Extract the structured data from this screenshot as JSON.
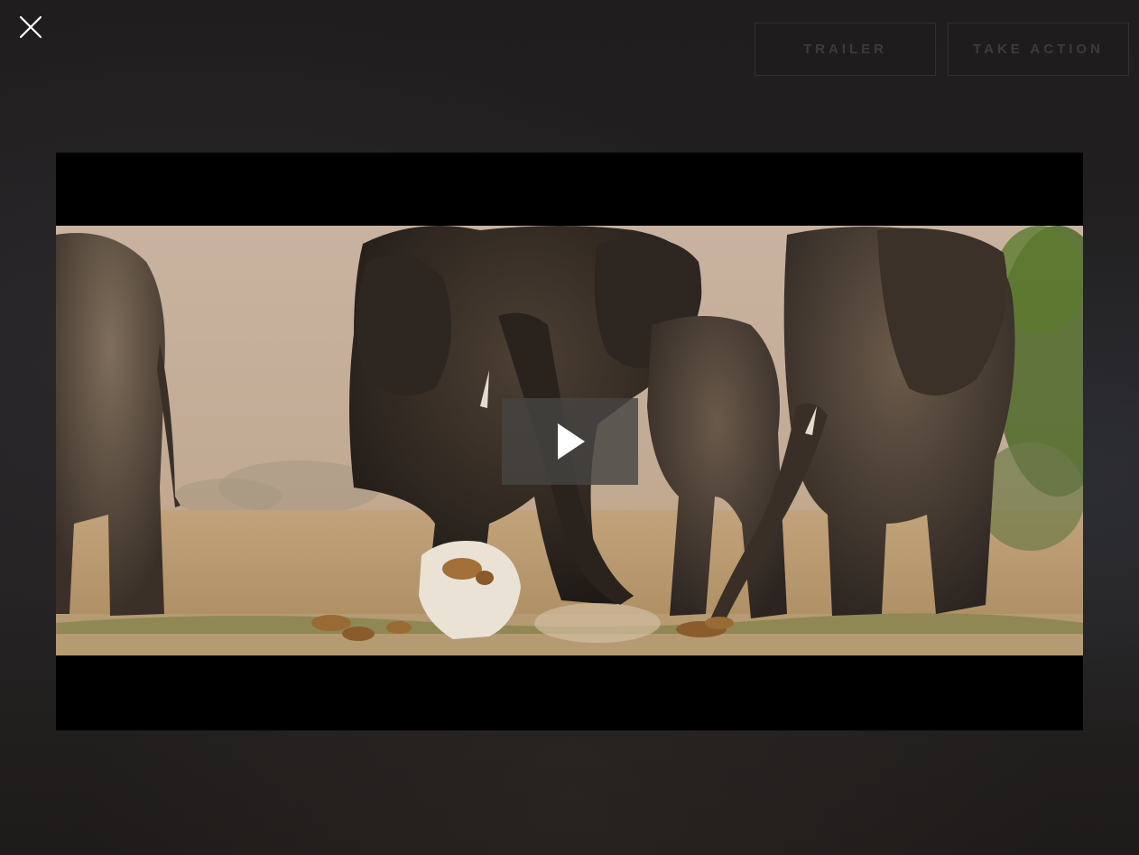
{
  "overlay": {
    "close_icon": "close-icon"
  },
  "header": {
    "buttons": [
      {
        "label": "TRAILER"
      },
      {
        "label": "TAKE ACTION"
      }
    ]
  },
  "player": {
    "play_icon": "play-icon",
    "scene": "elephant-herd-video-frame"
  },
  "colors": {
    "background": "#1d1b1a",
    "button_text": "#3e3b3a",
    "button_border": "#33302f",
    "play_button_bg": "#464442"
  }
}
